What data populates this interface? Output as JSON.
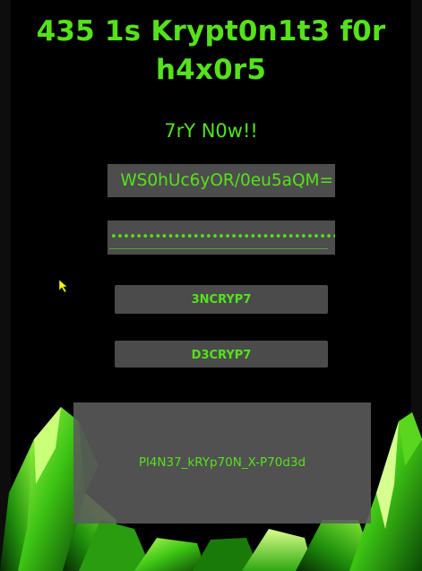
{
  "app": {
    "title_line1": "435 1s Krypt0n1t3 f0r",
    "title_line2": "h4x0r5",
    "subtitle": "7rY N0w!!"
  },
  "form": {
    "key_value": "WS0hUc6yOR/0eu5aQM=",
    "password_mask": "•••••••••••••••••••••••••••••••••••••••••••••"
  },
  "buttons": {
    "encrypt_label": "3NCRYP7",
    "decrypt_label": "D3CRYP7"
  },
  "output": {
    "text": "Pl4N37_kRYp70N_X-P70d3d"
  },
  "colors": {
    "accent": "#55e21a",
    "background": "#000000",
    "field_bg": "#4d4d4d"
  },
  "decor": {
    "background_image": "kryptonite-crystal",
    "pointer": "cursor-arrow-icon"
  }
}
